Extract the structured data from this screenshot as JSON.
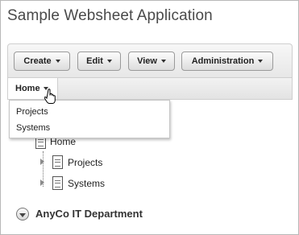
{
  "app": {
    "title": "Sample Websheet Application"
  },
  "toolbar": {
    "buttons": [
      {
        "label": "Create"
      },
      {
        "label": "Edit"
      },
      {
        "label": "View"
      },
      {
        "label": "Administration"
      }
    ]
  },
  "tabs": {
    "home_label": "Home"
  },
  "dropdown": {
    "items": [
      {
        "label": "Projects"
      },
      {
        "label": "Systems"
      }
    ]
  },
  "tree": {
    "root_label": "Home",
    "children": [
      {
        "label": "Projects"
      },
      {
        "label": "Systems"
      }
    ]
  },
  "section": {
    "title": "AnyCo IT Department"
  }
}
